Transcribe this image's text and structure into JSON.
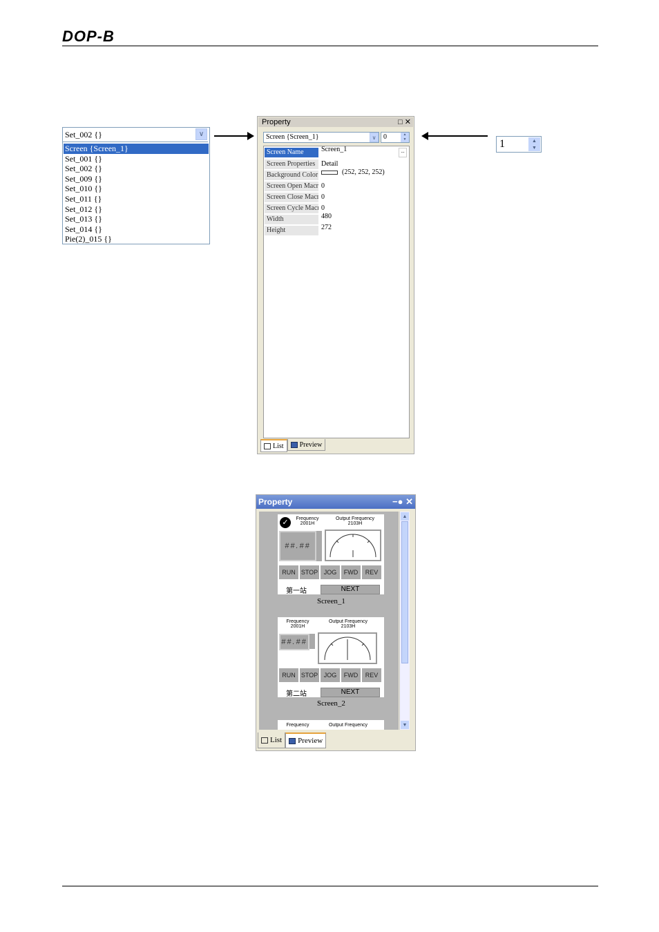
{
  "header": {
    "logo": "DOP-B"
  },
  "dropdown": {
    "selected": "Set_002 {}",
    "items": [
      "Screen {Screen_1}",
      "Set_001 {}",
      "Set_002 {}",
      "Set_009 {}",
      "Set_010 {}",
      "Set_011 {}",
      "Set_012 {}",
      "Set_013 {}",
      "Set_014 {}",
      "Pie(2)_015 {}"
    ]
  },
  "spinner": {
    "value": "1"
  },
  "panel1": {
    "title": "Property",
    "combo": "Screen {Screen_1}",
    "number": "0",
    "rows": [
      {
        "key": "Screen Name",
        "value": "Screen_1"
      },
      {
        "key": "Screen Properties",
        "value": "Detail"
      },
      {
        "key": "Background Color",
        "value": "(252, 252, 252)"
      },
      {
        "key": "Screen Open Macro",
        "value": "0"
      },
      {
        "key": "Screen Close Macro",
        "value": "0"
      },
      {
        "key": "Screen Cycle Macro",
        "value": "0"
      },
      {
        "key": "Width",
        "value": "480"
      },
      {
        "key": "Height",
        "value": "272"
      }
    ],
    "tab_list": "List",
    "tab_preview": "Preview"
  },
  "panel2": {
    "title": "Property",
    "screens": [
      {
        "freq_label": "Frequency",
        "freq_sub": "2001H",
        "out_label": "Output Frequency",
        "out_sub": "2103H",
        "display": "##.##",
        "buttons": [
          "RUN",
          "STOP",
          "JOG",
          "FWD",
          "REV"
        ],
        "cn_label": "第一站",
        "next": "NEXT",
        "name": "Screen_1"
      },
      {
        "freq_label": "Frequency",
        "freq_sub": "2001H",
        "out_label": "Output Frequency",
        "out_sub": "2103H",
        "display": "##.##",
        "buttons": [
          "RUN",
          "STOP",
          "JOG",
          "FWD",
          "REV"
        ],
        "cn_label": "第二站",
        "next": "NEXT",
        "name": "Screen_2"
      },
      {
        "freq_label": "Frequency",
        "out_label": "Output Frequency"
      }
    ],
    "tab_list": "List",
    "tab_preview": "Preview"
  }
}
